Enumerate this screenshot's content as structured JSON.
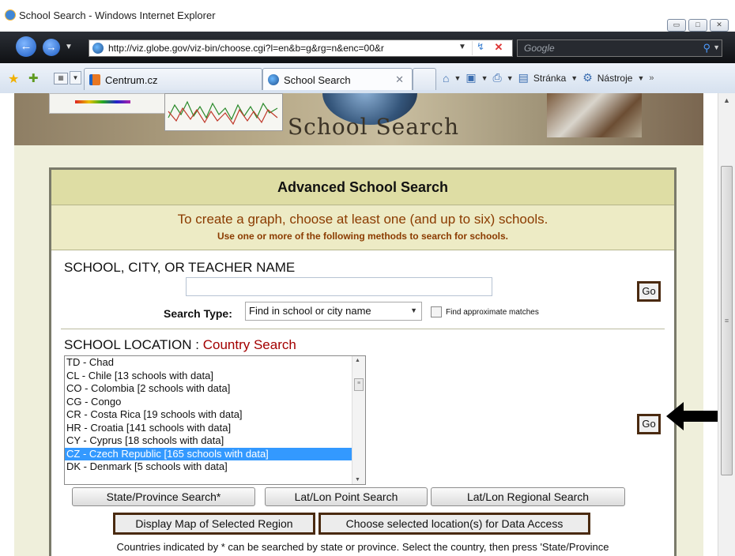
{
  "window": {
    "title": "School Search - Windows Internet Explorer",
    "controls": {
      "minimize": "▭",
      "maximize": "□",
      "close": "✕"
    }
  },
  "address_bar": {
    "url": "http://viz.globe.gov/viz-bin/choose.cgi?l=en&b=g&rg=n&enc=00&r",
    "search_placeholder": "Google"
  },
  "tabs": [
    {
      "label": "Centrum.cz",
      "icon": "centrum-icon"
    },
    {
      "label": "School Search",
      "icon": "globe-icon",
      "active": true
    }
  ],
  "command_bar": {
    "page_label": "Stránka",
    "tools_label": "Nástroje"
  },
  "banner": {
    "title": "School Search"
  },
  "search_panel": {
    "heading": "Advanced School Search",
    "subheading": "To create a graph, choose at least one (and up to six) schools.",
    "instruction": "Use one or more of the following methods to search for schools.",
    "name_section": {
      "label": "SCHOOL, CITY, OR TEACHER NAME",
      "input_value": "",
      "go_label": "Go",
      "search_type_label": "Search Type:",
      "search_type_value": "Find in school or city name",
      "approx_label": "Find approximate matches",
      "approx_checked": false
    },
    "location_section": {
      "label": "SCHOOL LOCATION :",
      "mode": "Country Search",
      "countries": [
        "TD - Chad",
        "CL - Chile [13 schools with data]",
        "CO - Colombia [2 schools with data]",
        "CG - Congo",
        "CR - Costa Rica [19 schools with data]",
        "HR - Croatia [141 schools with data]",
        "CY - Cyprus [18 schools with data]",
        "CZ - Czech Republic [165 schools with data]",
        "DK - Denmark [5 schools with data]"
      ],
      "selected_country": "CZ - Czech Republic [165 schools with data]",
      "go_label": "Go"
    },
    "buttons": {
      "state_search": "State/Province Search*",
      "point_search": "Lat/Lon Point Search",
      "regional_search": "Lat/Lon Regional Search",
      "display_map": "Display Map of Selected Region",
      "choose_locations": "Choose selected location(s) for Data Access"
    },
    "footnote": "Countries indicated by * can be searched by state or province. Select the country, then press 'State/Province"
  },
  "colors": {
    "heading_bg": "#dedda4",
    "sub_bg": "#edebc5",
    "accent_text": "#8b3b00",
    "country_mode": "#a30000",
    "selection": "#3399ff"
  }
}
